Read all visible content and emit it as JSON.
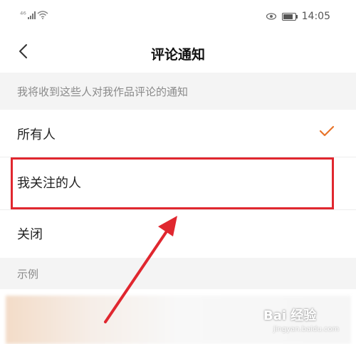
{
  "status_bar": {
    "time": "14:05",
    "signal_text": "⁴⁶",
    "icons": [
      "signal-icon",
      "wifi-icon",
      "eye-icon",
      "battery-icon"
    ]
  },
  "nav": {
    "title": "评论通知",
    "back_icon": "chevron-left-icon"
  },
  "section1": {
    "header": "我将收到这些人对我作品评论的通知",
    "options": [
      {
        "label": "所有人",
        "selected": true
      },
      {
        "label": "我关注的人",
        "selected": false
      },
      {
        "label": "关闭",
        "selected": false
      }
    ]
  },
  "section2": {
    "header": "示例"
  },
  "colors": {
    "accent": "#e8742a",
    "highlight": "#e0272f",
    "section_bg": "#f4f4f4"
  },
  "watermark": {
    "logo": "Bai 经验",
    "url": "jingyan.baidu.com"
  }
}
